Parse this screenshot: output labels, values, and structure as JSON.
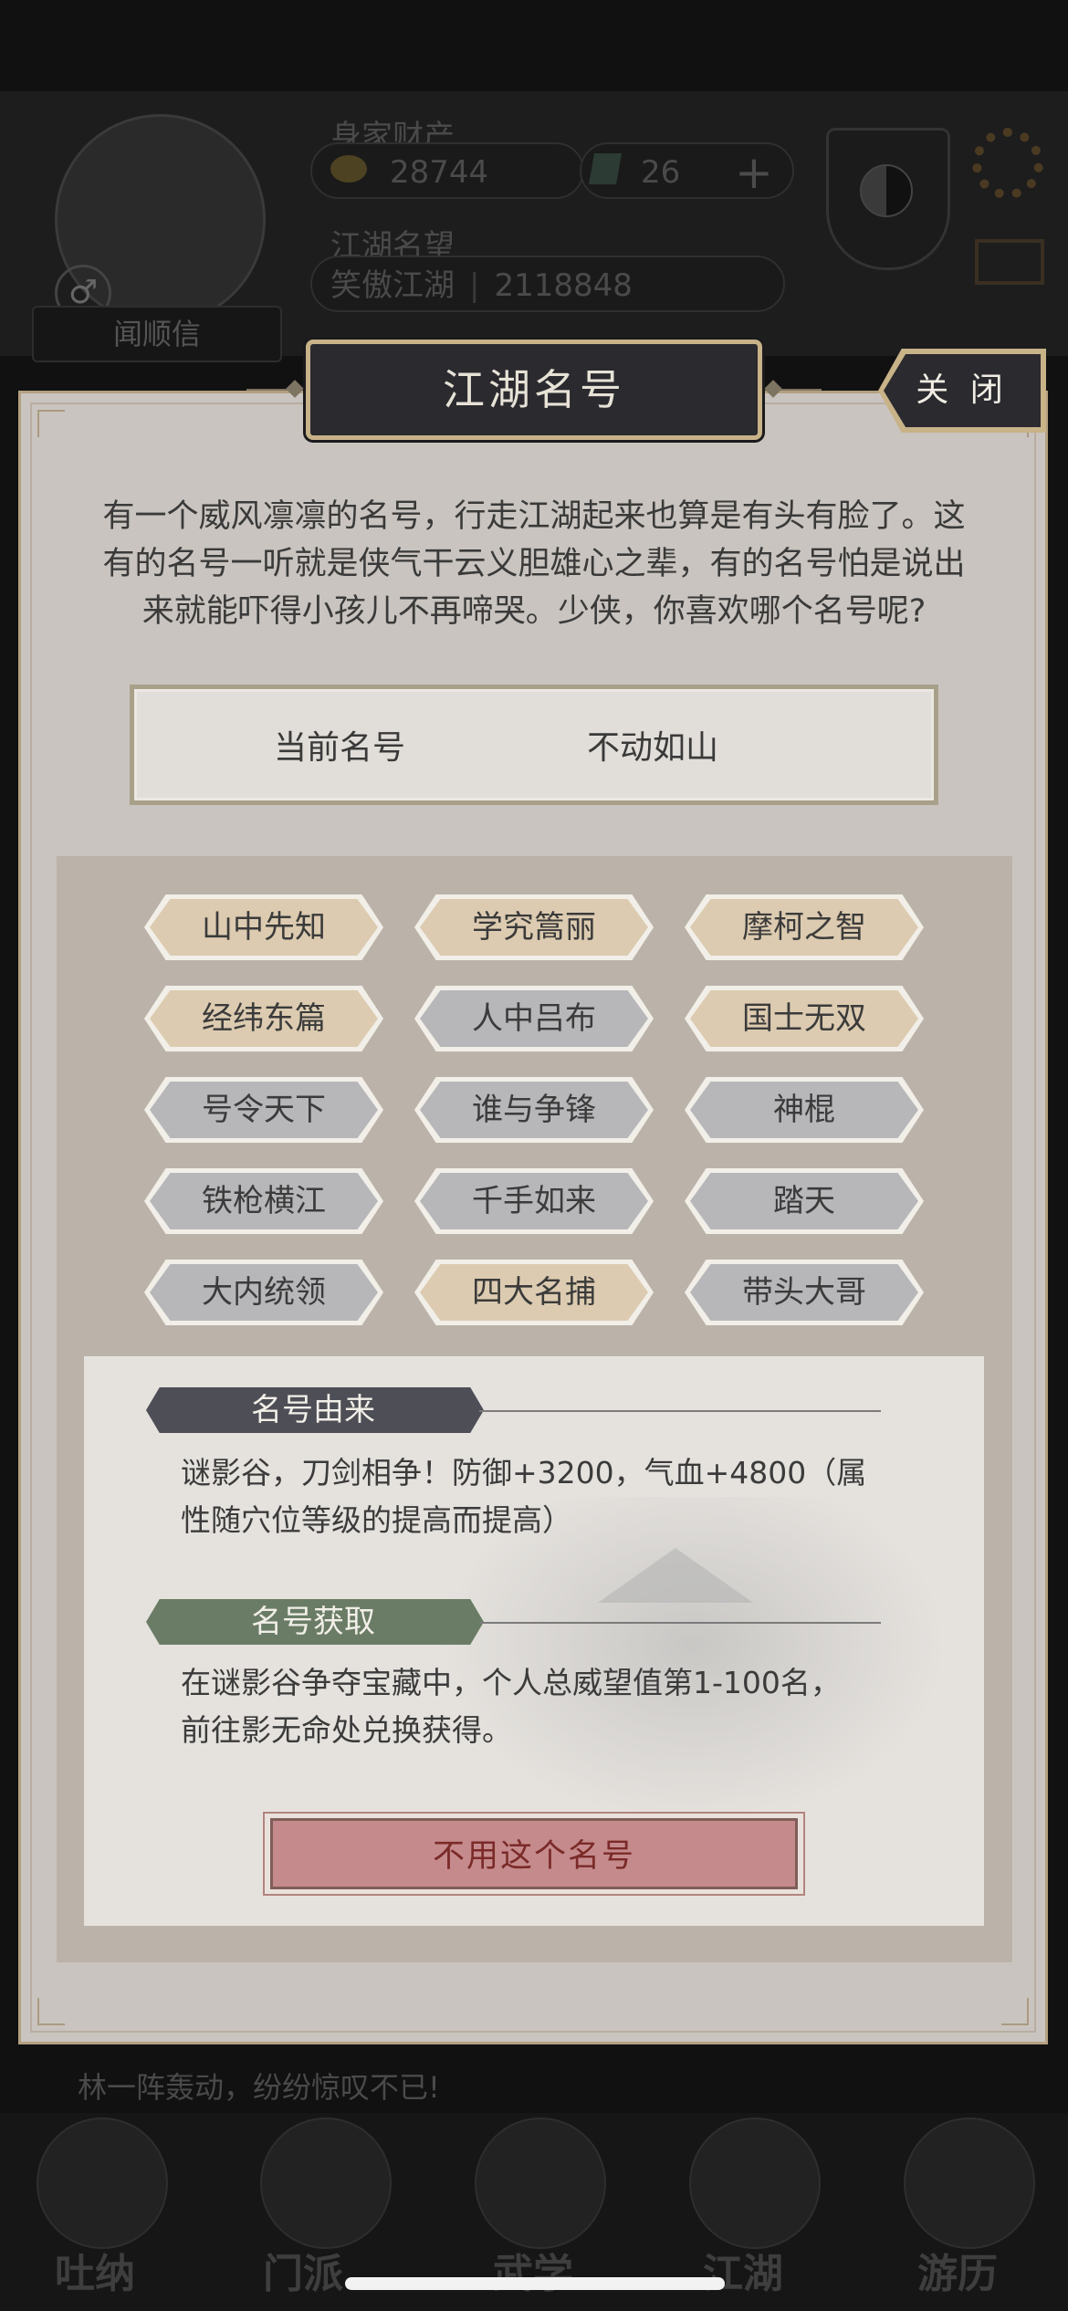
{
  "background": {
    "resources_label": "身家财产",
    "coins": "28744",
    "gems": "26",
    "reputation_label": "江湖名望",
    "title_name": "笑傲江湖",
    "reputation_value": "2118848",
    "player_name": "闻顺信",
    "ticker_text": "林一阵轰动，纷纷惊叹不已!",
    "bottom_tabs": [
      "吐纳",
      "门派",
      "武学",
      "江湖",
      "游历"
    ]
  },
  "dialog": {
    "title": "江湖名号",
    "close_label": "关 闭",
    "description": "有一个威风凛凛的名号，行走江湖起来也算是有头有脸了。这有的名号一听就是侠气干云义胆雄心之辈，有的名号怕是说出来就能吓得小孩儿不再啼哭。少侠，你喜欢哪个名号呢?",
    "current_label": "当前名号",
    "current_value": "不动如山",
    "titles": [
      {
        "label": "山中先知",
        "style": "gold"
      },
      {
        "label": "学究篙丽",
        "style": "gold"
      },
      {
        "label": "摩柯之智",
        "style": "gold"
      },
      {
        "label": "经纬东篇",
        "style": "gold"
      },
      {
        "label": "人中吕布",
        "style": "gray"
      },
      {
        "label": "国士无双",
        "style": "gold"
      },
      {
        "label": "号令天下",
        "style": "gray"
      },
      {
        "label": "谁与争锋",
        "style": "gray"
      },
      {
        "label": "神棍",
        "style": "gray"
      },
      {
        "label": "铁枪横江",
        "style": "gray"
      },
      {
        "label": "千手如来",
        "style": "gray"
      },
      {
        "label": "踏天",
        "style": "gray"
      },
      {
        "label": "大内统领",
        "style": "gray"
      },
      {
        "label": "四大名捕",
        "style": "gold"
      },
      {
        "label": "带头大哥",
        "style": "gray"
      }
    ],
    "origin_heading": "名号由来",
    "origin_text_line1": "谜影谷，刀剑相争！防御+3200，气血+4800（属",
    "origin_text_line2": "性随穴位等级的提高而提高）",
    "obtain_heading": "名号获取",
    "obtain_text_line1": "在谜影谷争夺宝藏中，个人总威望值第1-100名，",
    "obtain_text_line2": "前往影无命处兑换获得。",
    "no_use_label": "不用这个名号"
  },
  "colors": {
    "gold_option": "#dccbb0",
    "gray_option": "#b7b7ba",
    "origin_heading": "#4d4e56",
    "obtain_heading": "#6a7c66",
    "no_use_button": "#c58a8c"
  }
}
